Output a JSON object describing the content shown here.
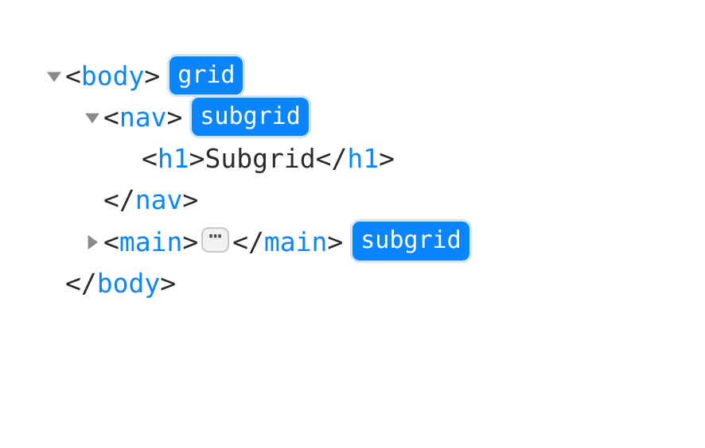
{
  "tree": {
    "body": {
      "tag": "body",
      "badge": "grid",
      "close_tag": "body"
    },
    "nav": {
      "tag": "nav",
      "badge": "subgrid",
      "close_tag": "nav"
    },
    "h1": {
      "tag": "h1",
      "text": "Subgrid",
      "close_tag": "h1"
    },
    "main": {
      "tag": "main",
      "ellipsis": "⋯",
      "close_tag": "main",
      "badge": "subgrid"
    }
  },
  "glyphs": {
    "lt": "<",
    "gt": ">",
    "lts": "</"
  }
}
